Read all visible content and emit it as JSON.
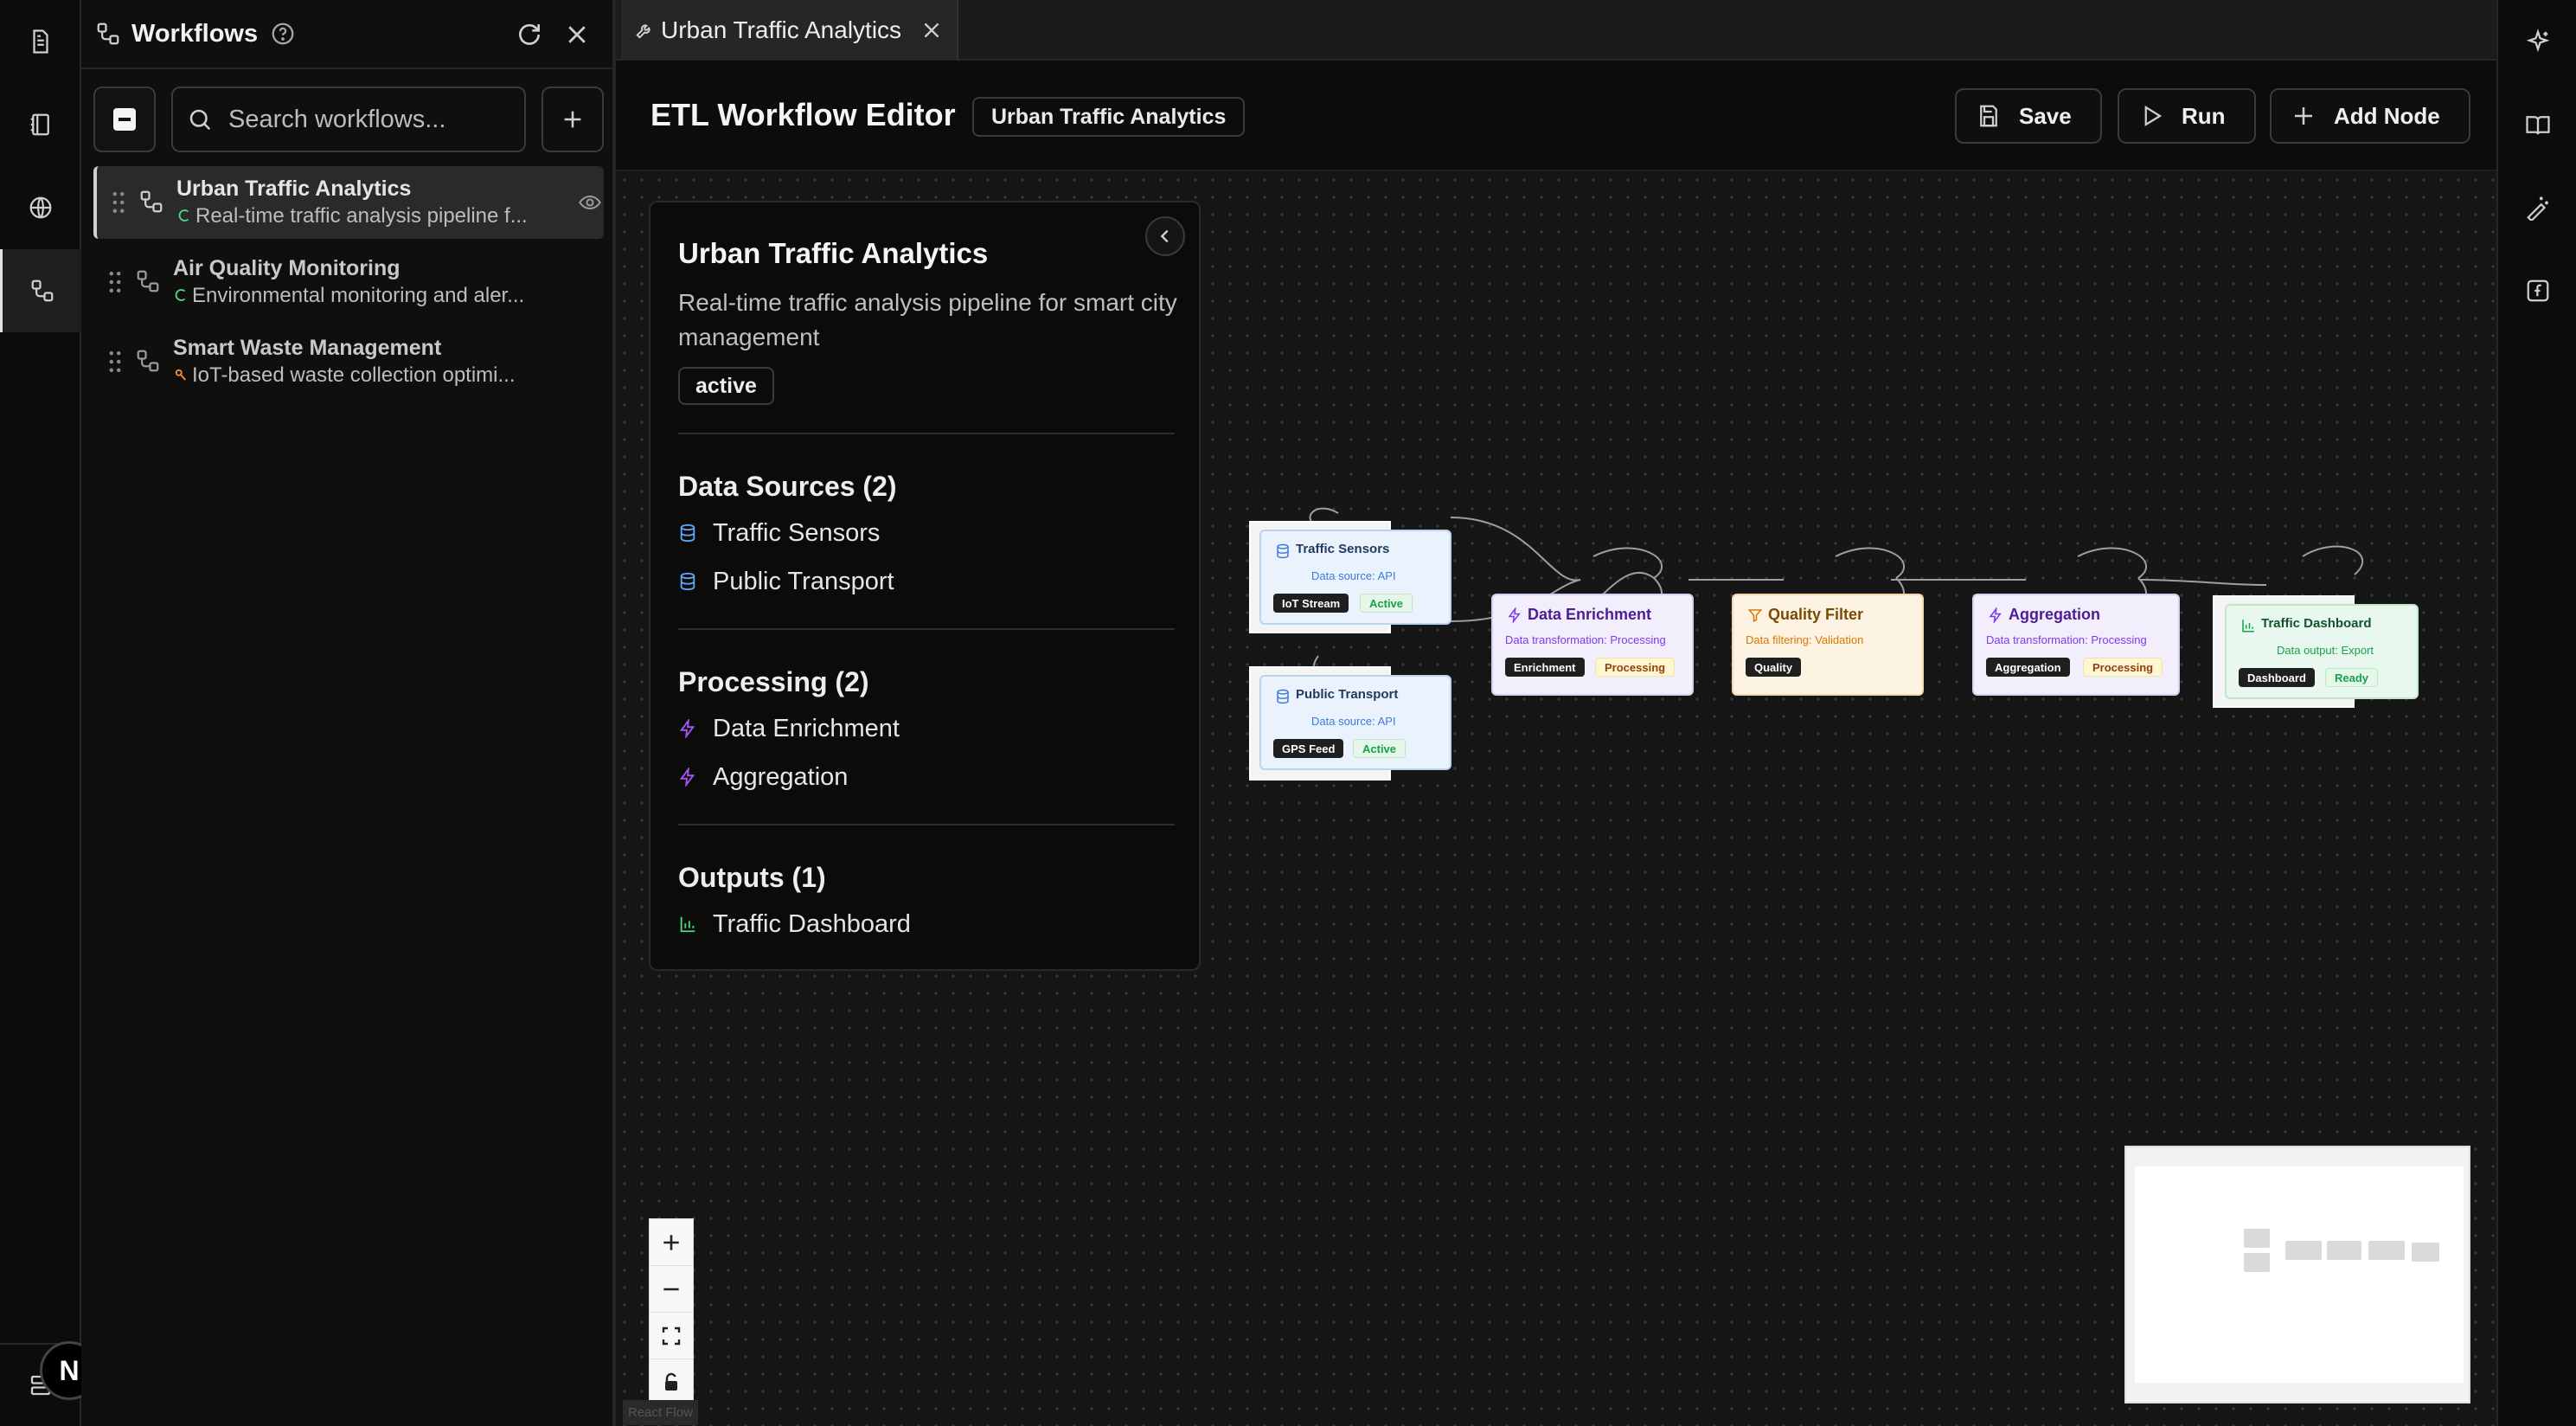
{
  "sidebar": {
    "title": "Workflows",
    "search_placeholder": "Search workflows...",
    "items": [
      {
        "name": "Urban Traffic Analytics",
        "description": "Real-time traffic analysis pipeline f..."
      },
      {
        "name": "Air Quality Monitoring",
        "description": "Environmental monitoring and aler..."
      },
      {
        "name": "Smart Waste Management",
        "description": "IoT-based waste collection optimi..."
      }
    ]
  },
  "tabs": [
    {
      "label": "Urban Traffic Analytics"
    }
  ],
  "header": {
    "title": "ETL Workflow Editor",
    "badge": "Urban Traffic Analytics",
    "save_label": "Save",
    "run_label": "Run",
    "add_node_label": "Add Node"
  },
  "info_panel": {
    "title": "Urban Traffic Analytics",
    "description": "Real-time traffic analysis pipeline for smart city management",
    "status": "active",
    "data_sources_title": "Data Sources (2)",
    "data_sources": [
      "Traffic Sensors",
      "Public Transport"
    ],
    "processing_title": "Processing (2)",
    "processing": [
      "Data Enrichment",
      "Aggregation"
    ],
    "outputs_title": "Outputs (1)",
    "outputs": [
      "Traffic Dashboard"
    ]
  },
  "nodes": {
    "traffic_sensors": {
      "title": "Traffic Sensors",
      "subtitle": "Data source: API",
      "tag": "IoT Stream",
      "status": "Active"
    },
    "public_transport": {
      "title": "Public Transport",
      "subtitle": "Data source: API",
      "tag": "GPS Feed",
      "status": "Active"
    },
    "data_enrichment": {
      "title": "Data Enrichment",
      "subtitle": "Data transformation: Processing",
      "tag": "Enrichment",
      "status": "Processing"
    },
    "quality_filter": {
      "title": "Quality Filter",
      "subtitle": "Data filtering: Validation",
      "tag": "Quality"
    },
    "aggregation": {
      "title": "Aggregation",
      "subtitle": "Data transformation: Processing",
      "tag": "Aggregation",
      "status": "Processing"
    },
    "traffic_dashboard": {
      "title": "Traffic Dashboard",
      "subtitle": "Data output: Export",
      "tag": "Dashboard",
      "status": "Ready"
    }
  },
  "canvas": {
    "attribution": "React Flow"
  },
  "user": {
    "avatar_initial": "N"
  },
  "colors": {
    "source_bg": "#eaf3fd",
    "source_text": "#1e3a5f",
    "source_sub": "#3b7bd9",
    "process_bg": "#f3eefb",
    "process_text": "#4c1d95",
    "process_sub": "#7c3aed",
    "filter_bg": "#fdf3e2",
    "filter_text": "#7c4a03",
    "filter_sub": "#d97706",
    "output_bg": "#e9f8ee",
    "output_text": "#14532d",
    "output_sub": "#16a34a"
  }
}
